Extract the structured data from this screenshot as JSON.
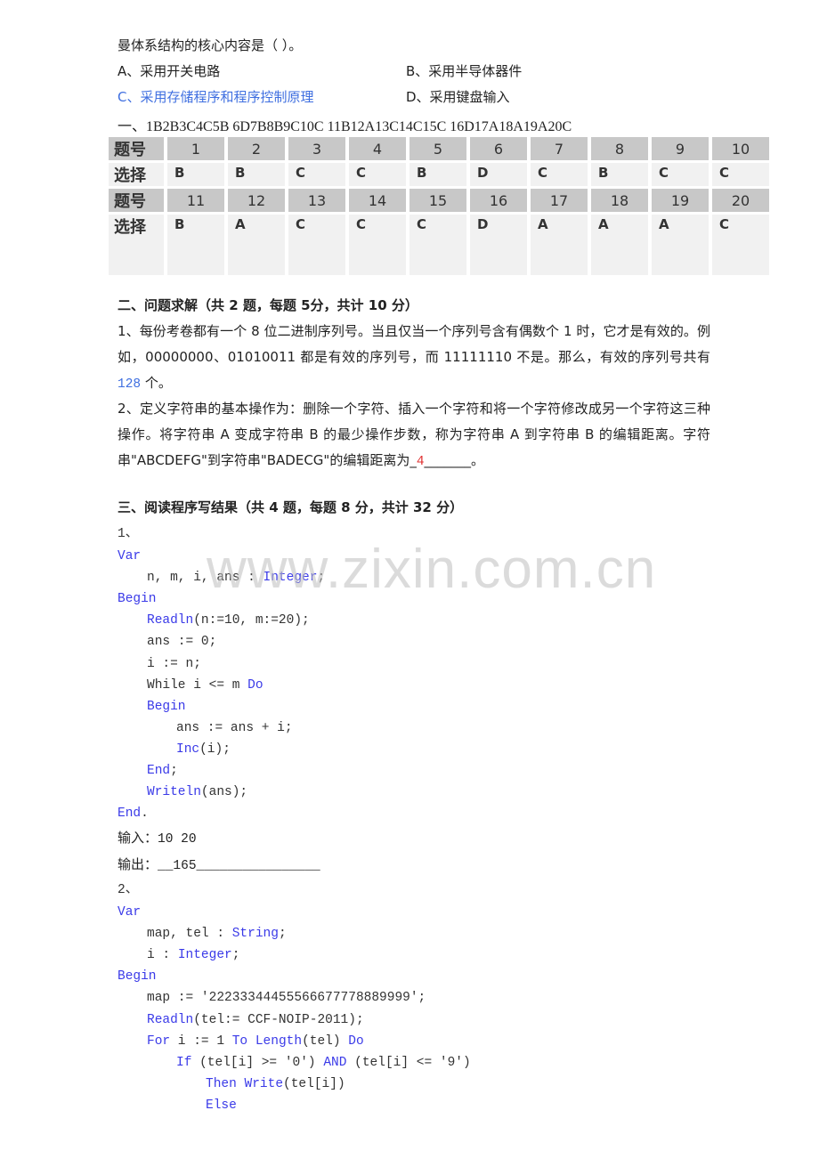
{
  "question_intro": "曼体系结构的核心内容是（    ）。",
  "options": {
    "a": "A、采用开关电路",
    "b": "B、采用半导体器件",
    "c": "C、采用存储程序和程序控制原理",
    "d": "D、采用键盘输入"
  },
  "answer_key_line": "一、1B2B3C4C5B 6D7B8B9C10C 11B12A13C14C15C 16D17A18A19A20C",
  "answer_table": {
    "row_label_number": "题号",
    "row_label_choice": "选择",
    "group1": {
      "numbers": [
        "1",
        "2",
        "3",
        "4",
        "5",
        "6",
        "7",
        "8",
        "9",
        "10"
      ],
      "choices": [
        "B",
        "B",
        "C",
        "C",
        "B",
        "D",
        "C",
        "B",
        "C",
        "C"
      ]
    },
    "group2": {
      "numbers": [
        "11",
        "12",
        "13",
        "14",
        "15",
        "16",
        "17",
        "18",
        "19",
        "20"
      ],
      "choices": [
        "B",
        "A",
        "C",
        "C",
        "C",
        "D",
        "A",
        "A",
        "A",
        "C"
      ]
    }
  },
  "section2": {
    "title": "二、问题求解（共 2 题，每题 5分，共计 10 分）",
    "q1_text": "1、每份考卷都有一个 8 位二进制序列号。当且仅当一个序列号含有偶数个 1 时，它才是有效的。例如，00000000、01010011 都是有效的序列号，而 11111110 不是。那么，有效的序列号共有",
    "q1_answer": "128",
    "q1_suffix": " 个。",
    "q2_text": "2、定义字符串的基本操作为：删除一个字符、插入一个字符和将一个字符修改成另一个字符这三种操作。将字符串 A 变成字符串 B 的最少操作步数，称为字符串 A 到字符串 B 的编辑距离。字符串\"ABCDEFG\"到字符串\"BADECG\"的编辑距离为_",
    "q2_answer": "4",
    "q2_suffix": "_______。"
  },
  "section3": {
    "title": "三、阅读程序写结果（共 4 题，每题 8 分，共计 32 分）",
    "p1": {
      "number": "1、",
      "lines": [
        {
          "indent": 0,
          "parts": [
            {
              "t": "Var",
              "kw": true
            }
          ]
        },
        {
          "indent": 1,
          "parts": [
            {
              "t": "n, m, i, ans : ",
              "kw": false
            },
            {
              "t": "Integer",
              "kw": true
            },
            {
              "t": ";",
              "kw": false
            }
          ]
        },
        {
          "indent": 0,
          "parts": [
            {
              "t": "Begin",
              "kw": true
            }
          ]
        },
        {
          "indent": 1,
          "parts": [
            {
              "t": "Readln",
              "kw": true
            },
            {
              "t": "(n:=10, m:=20);",
              "kw": false
            }
          ]
        },
        {
          "indent": 1,
          "parts": [
            {
              "t": "ans := 0;",
              "kw": false
            }
          ]
        },
        {
          "indent": 1,
          "parts": [
            {
              "t": "i := n;",
              "kw": false
            }
          ]
        },
        {
          "indent": 1,
          "parts": [
            {
              "t": "While i <= m ",
              "kw": false
            },
            {
              "t": "Do",
              "kw": true
            }
          ]
        },
        {
          "indent": 1,
          "parts": [
            {
              "t": "Begin",
              "kw": true
            }
          ]
        },
        {
          "indent": 2,
          "parts": [
            {
              "t": "ans := ans + i;",
              "kw": false
            }
          ]
        },
        {
          "indent": 2,
          "parts": [
            {
              "t": "Inc",
              "kw": true
            },
            {
              "t": "(i);",
              "kw": false
            }
          ]
        },
        {
          "indent": 1,
          "parts": [
            {
              "t": "End",
              "kw": true
            },
            {
              "t": ";",
              "kw": false
            }
          ]
        },
        {
          "indent": 1,
          "parts": [
            {
              "t": "Writeln",
              "kw": true
            },
            {
              "t": "(ans);",
              "kw": false
            }
          ]
        },
        {
          "indent": 0,
          "parts": [
            {
              "t": "End",
              "kw": true
            },
            {
              "t": ".",
              "kw": false
            }
          ]
        }
      ],
      "input_label": "输入：",
      "input_value": "10 20",
      "output_label": "输出：",
      "output_value": "__165________________"
    },
    "p2": {
      "number": "2、",
      "lines": [
        {
          "indent": 0,
          "parts": [
            {
              "t": "Var",
              "kw": true
            }
          ]
        },
        {
          "indent": 1,
          "parts": [
            {
              "t": "map, tel : ",
              "kw": false
            },
            {
              "t": "String",
              "kw": true
            },
            {
              "t": ";",
              "kw": false
            }
          ]
        },
        {
          "indent": 1,
          "parts": [
            {
              "t": "i : ",
              "kw": false
            },
            {
              "t": "Integer",
              "kw": true
            },
            {
              "t": ";",
              "kw": false
            }
          ]
        },
        {
          "indent": 0,
          "parts": [
            {
              "t": "Begin",
              "kw": true
            }
          ]
        },
        {
          "indent": 1,
          "parts": [
            {
              "t": "map := '22233344455566677778889999';",
              "kw": false
            }
          ]
        },
        {
          "indent": 1,
          "parts": [
            {
              "t": "Readln",
              "kw": true
            },
            {
              "t": "(tel:= CCF-NOIP-2011);",
              "kw": false
            }
          ]
        },
        {
          "indent": 1,
          "parts": [
            {
              "t": "For",
              "kw": true
            },
            {
              "t": " i := 1 ",
              "kw": false
            },
            {
              "t": "To",
              "kw": true
            },
            {
              "t": " ",
              "kw": false
            },
            {
              "t": "Length",
              "kw": true
            },
            {
              "t": "(tel) ",
              "kw": false
            },
            {
              "t": "Do",
              "kw": true
            }
          ]
        },
        {
          "indent": 2,
          "parts": [
            {
              "t": "If",
              "kw": true
            },
            {
              "t": " (tel[i] >= '0') ",
              "kw": false
            },
            {
              "t": "AND",
              "kw": true
            },
            {
              "t": " (tel[i] <= '9')",
              "kw": false
            }
          ]
        },
        {
          "indent": 3,
          "parts": [
            {
              "t": "Then",
              "kw": true
            },
            {
              "t": " ",
              "kw": false
            },
            {
              "t": "Write",
              "kw": true
            },
            {
              "t": "(tel[i])",
              "kw": false
            }
          ]
        },
        {
          "indent": 3,
          "parts": [
            {
              "t": "Else",
              "kw": true
            }
          ]
        }
      ]
    }
  },
  "watermark": "www.zixin.com.cn"
}
